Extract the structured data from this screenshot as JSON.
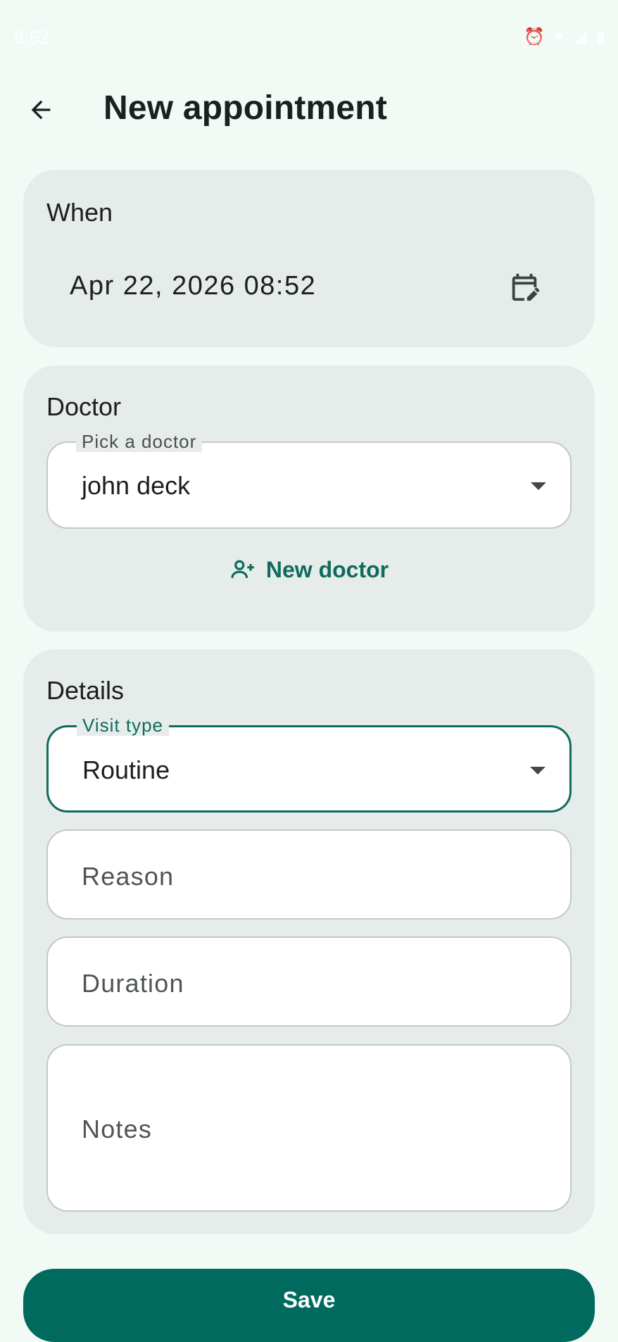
{
  "status_bar": {
    "time": "8:52"
  },
  "app_bar": {
    "title": "New appointment"
  },
  "when": {
    "section_title": "When",
    "datetime": "Apr 22, 2026 08:52"
  },
  "doctor": {
    "section_title": "Doctor",
    "field_label": "Pick a doctor",
    "selected": "john deck",
    "new_doctor_label": "New doctor"
  },
  "details": {
    "section_title": "Details",
    "visit_type_label": "Visit type",
    "visit_type_value": "Routine",
    "reason_placeholder": "Reason",
    "duration_placeholder": "Duration",
    "notes_placeholder": "Notes"
  },
  "actions": {
    "save_label": "Save"
  },
  "colors": {
    "accent": "#0f6b5e",
    "primary_button": "#006a5e",
    "card_bg": "#e6ecea",
    "page_bg": "#f2faf6"
  }
}
